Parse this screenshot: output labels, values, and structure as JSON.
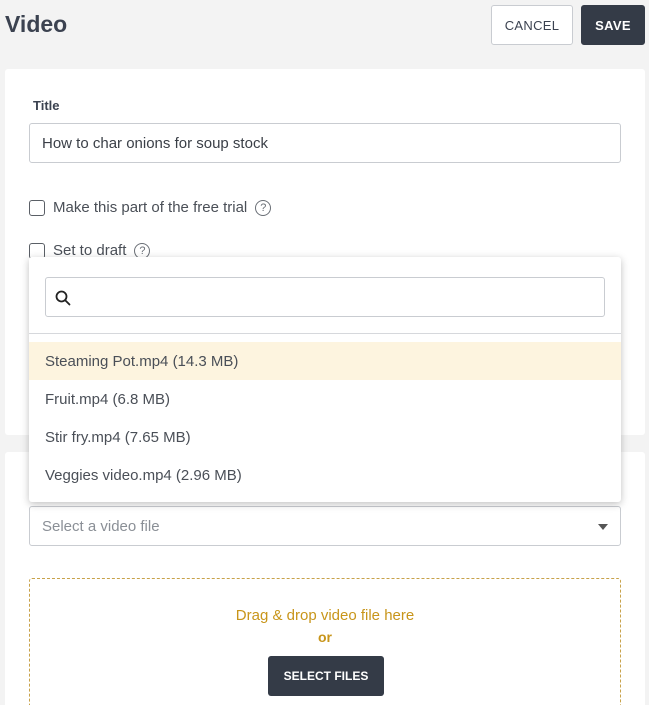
{
  "header": {
    "title": "Video",
    "cancel_label": "CANCEL",
    "save_label": "SAVE"
  },
  "form": {
    "title_label": "Title",
    "title_value": "How to char onions for soup stock",
    "free_trial_label": "Make this part of the free trial",
    "draft_label": "Set to draft",
    "help_glyph": "?"
  },
  "dropdown": {
    "search_placeholder": "",
    "items": [
      "Steaming Pot.mp4 (14.3 MB)",
      "Fruit.mp4 (6.8 MB)",
      "Stir fry.mp4 (7.65 MB)",
      "Veggies video.mp4 (2.96 MB)"
    ]
  },
  "video_select": {
    "placeholder": "Select a video file"
  },
  "dropzone": {
    "main_text": "Drag & drop video file here",
    "or_text": "or",
    "button_label": "SELECT FILES"
  },
  "colors": {
    "accent": "#c8951a",
    "dark_button": "#343b47",
    "highlight": "#fdf4df"
  }
}
